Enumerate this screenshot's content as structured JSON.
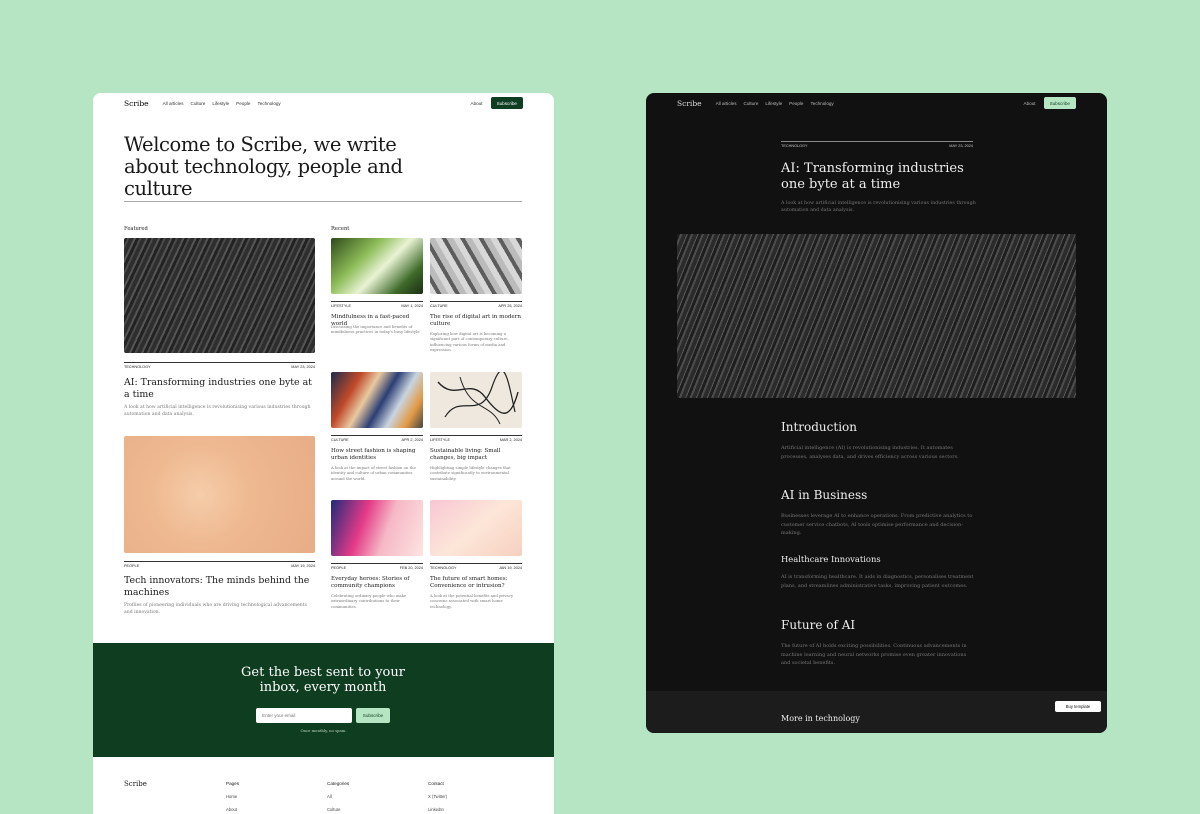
{
  "light": {
    "nav": {
      "brand": "Scribe",
      "links": [
        "All articles",
        "Culture",
        "Lifestyle",
        "People",
        "Technology"
      ],
      "about": "About",
      "subscribe": "Subscribe"
    },
    "hero": "Welcome to Scribe, we write about technology, people and culture",
    "featured_label": "Featured",
    "recent_label": "Recent",
    "featured": [
      {
        "category": "TECHNOLOGY",
        "date": "MAY 23, 2024",
        "title": "AI: Transforming industries one byte at a time",
        "desc": "A look at how artificial intelligence is revolutionising various industries through automation and data analysis."
      },
      {
        "category": "PEOPLE",
        "date": "MAY 19, 2024",
        "title": "Tech innovators: The minds behind the machines",
        "desc": "Profiles of pioneering individuals who are driving technological advancements and innovation."
      }
    ],
    "recent": [
      {
        "category": "LIFESTYLE",
        "date": "MAY 1, 2024",
        "title": "Mindfulness in a fast-paced world",
        "desc": "Discussing the importance and benefits of mindfulness practices in today's busy lifestyle"
      },
      {
        "category": "CULTURE",
        "date": "APR 25, 2024",
        "title": "The rise of digital art in modern culture",
        "desc": "Exploring how digital art is becoming a significant part of contemporary culture, influencing various forms of media and expression."
      },
      {
        "category": "CULTURE",
        "date": "APR 2, 2024",
        "title": "How street fashion is shaping urban identities",
        "desc": "A look at the impact of street fashion on the identity and culture of urban communities around the world."
      },
      {
        "category": "LIFESTYLE",
        "date": "MAR 2, 2024",
        "title": "Sustainable living: Small changes, big impact",
        "desc": "Highlighting simple lifestyle changes that contribute significantly to environmental sustainability."
      },
      {
        "category": "PEOPLE",
        "date": "FEB 20, 2024",
        "title": "Everyday heroes: Stories of community champions",
        "desc": "Celebrating ordinary people who make extraordinary contributions to their communities."
      },
      {
        "category": "TECHNOLOGY",
        "date": "JAN 19, 2024",
        "title": "The future of smart homes: Convenience or intrusion?",
        "desc": "A look at the potential benefits and privacy concerns associated with smart home technology."
      }
    ],
    "cta": {
      "heading": "Get the best sent to your inbox, every month",
      "placeholder": "Enter your email",
      "button": "Subscribe",
      "note": "Once monthly, no spam."
    },
    "footer": {
      "brand": "Scribe",
      "columns": [
        {
          "heading": "Pages",
          "links": [
            "Home",
            "About"
          ]
        },
        {
          "heading": "Categories",
          "links": [
            "All",
            "Culture"
          ]
        },
        {
          "heading": "Contact",
          "links": [
            "X (Twitter)",
            "LinkedIn"
          ]
        }
      ]
    }
  },
  "dark": {
    "nav": {
      "brand": "Scribe",
      "links": [
        "All articles",
        "Culture",
        "Lifestyle",
        "People",
        "Technology"
      ],
      "about": "About",
      "subscribe": "Subscribe"
    },
    "category": "TECHNOLOGY",
    "date": "MAY 23, 2024",
    "title": "AI: Transforming industries one byte at a time",
    "desc": "A look at how artificial intelligence is revolutionising various industries through automation and data analysis.",
    "sections": [
      {
        "heading": "Introduction",
        "body": "Artificial intelligence (AI) is revolutionising industries. It automates processes, analyses data, and drives efficiency across various sectors."
      },
      {
        "heading": "AI in Business",
        "body": "Businesses leverage AI to enhance operations. From predictive analytics to customer service chatbots, AI tools optimise performance and decision-making."
      },
      {
        "heading": "Healthcare Innovations",
        "body": "AI is transforming healthcare. It aids in diagnostics, personalises treatment plans, and streamlines administrative tasks, improving patient outcomes."
      },
      {
        "heading": "Future of AI",
        "body": "The future of AI holds exciting possibilities. Continuous advancements in machine learning and neural networks promise even greater innovations and societal benefits."
      }
    ],
    "more": "More in technology",
    "buy": "Buy template"
  }
}
